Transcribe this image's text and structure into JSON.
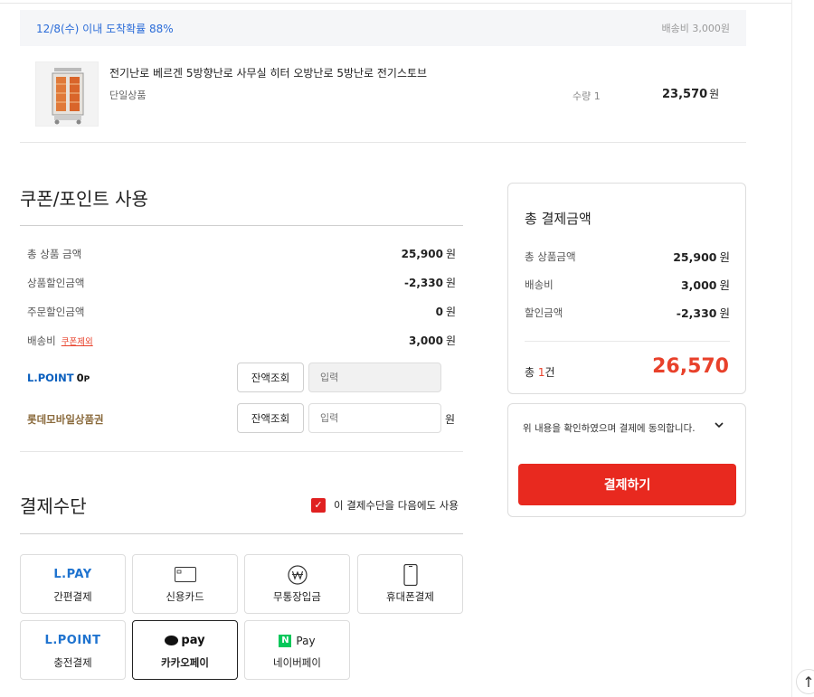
{
  "delivery": {
    "eta": "12/8(수) 이내 도착확률 88%",
    "shipping_fee": "배송비 3,000원"
  },
  "product": {
    "name": "전기난로 베르겐 5방향난로 사무실 히터 오방난로 5방난로 전기스토브",
    "option": "단일상품",
    "qty": "수량 1",
    "price": "23,570",
    "price_unit": "원"
  },
  "coupon": {
    "title": "쿠폰/포인트 사용",
    "rows": [
      {
        "label": "총 상품 금액",
        "value": "25,900",
        "unit": "원"
      },
      {
        "label": "상품할인금액",
        "value": "-2,330",
        "unit": "원"
      },
      {
        "label": "주문할인금액",
        "value": "0",
        "unit": "원"
      },
      {
        "label": "배송비",
        "value": "3,000",
        "unit": "원",
        "tag": "쿠폰제외"
      }
    ],
    "lpoint": {
      "label": "L.POINT",
      "points": "0",
      "points_unit": "P",
      "balance_button": "잔액조회",
      "input_placeholder": "입력"
    },
    "mobile_voucher": {
      "label": "롯데모바일상품권",
      "balance_button": "잔액조회",
      "input_placeholder": "입력",
      "unit": "원"
    }
  },
  "payment": {
    "title": "결제수단",
    "reuse_label": "이 결제수단을 다음에도 사용",
    "reuse_checked": true,
    "methods": [
      {
        "logo": "L.PAY",
        "name": "간편결제",
        "icon": "lpay-logo"
      },
      {
        "logo": "",
        "name": "신용카드",
        "icon": "credit-card-icon"
      },
      {
        "logo": "",
        "name": "무통장입금",
        "icon": "won-coin-icon"
      },
      {
        "logo": "",
        "name": "휴대폰결제",
        "icon": "mobile-phone-icon"
      },
      {
        "logo": "L.POINT",
        "name": "충전결제",
        "icon": "lpoint-logo"
      },
      {
        "logo": "pay",
        "name": "카카오페이",
        "icon": "kakaopay-logo",
        "selected": true
      },
      {
        "logo": "Pay",
        "badge": "N",
        "name": "네이버페이",
        "icon": "naverpay-logo"
      }
    ]
  },
  "summary": {
    "title": "총 결제금액",
    "rows": [
      {
        "label": "총 상품금액",
        "value": "25,900",
        "unit": "원"
      },
      {
        "label": "배송비",
        "value": "3,000",
        "unit": "원"
      },
      {
        "label": "할인금액",
        "value": "-2,330",
        "unit": "원"
      }
    ],
    "count_prefix": "총 ",
    "count_num": "1",
    "count_suffix": "건",
    "total": "26,570"
  },
  "agreement": {
    "text": "위 내용을 확인하였으며 결제에 동의합니다.",
    "pay_button": "결제하기"
  },
  "colors": {
    "accent": "#e8291f",
    "price_red": "#e8412b",
    "lpay_blue": "#1f73cf",
    "naver_green": "#03c75a"
  }
}
